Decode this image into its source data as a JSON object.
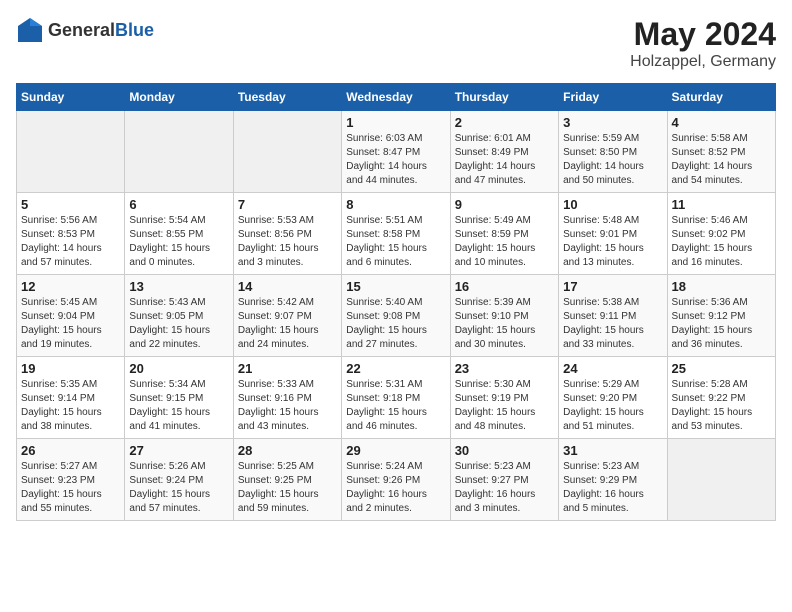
{
  "logo": {
    "general": "General",
    "blue": "Blue"
  },
  "title": "May 2024",
  "subtitle": "Holzappel, Germany",
  "days_of_week": [
    "Sunday",
    "Monday",
    "Tuesday",
    "Wednesday",
    "Thursday",
    "Friday",
    "Saturday"
  ],
  "weeks": [
    [
      {
        "day": "",
        "content": ""
      },
      {
        "day": "",
        "content": ""
      },
      {
        "day": "",
        "content": ""
      },
      {
        "day": "1",
        "content": "Sunrise: 6:03 AM\nSunset: 8:47 PM\nDaylight: 14 hours\nand 44 minutes."
      },
      {
        "day": "2",
        "content": "Sunrise: 6:01 AM\nSunset: 8:49 PM\nDaylight: 14 hours\nand 47 minutes."
      },
      {
        "day": "3",
        "content": "Sunrise: 5:59 AM\nSunset: 8:50 PM\nDaylight: 14 hours\nand 50 minutes."
      },
      {
        "day": "4",
        "content": "Sunrise: 5:58 AM\nSunset: 8:52 PM\nDaylight: 14 hours\nand 54 minutes."
      }
    ],
    [
      {
        "day": "5",
        "content": "Sunrise: 5:56 AM\nSunset: 8:53 PM\nDaylight: 14 hours\nand 57 minutes."
      },
      {
        "day": "6",
        "content": "Sunrise: 5:54 AM\nSunset: 8:55 PM\nDaylight: 15 hours\nand 0 minutes."
      },
      {
        "day": "7",
        "content": "Sunrise: 5:53 AM\nSunset: 8:56 PM\nDaylight: 15 hours\nand 3 minutes."
      },
      {
        "day": "8",
        "content": "Sunrise: 5:51 AM\nSunset: 8:58 PM\nDaylight: 15 hours\nand 6 minutes."
      },
      {
        "day": "9",
        "content": "Sunrise: 5:49 AM\nSunset: 8:59 PM\nDaylight: 15 hours\nand 10 minutes."
      },
      {
        "day": "10",
        "content": "Sunrise: 5:48 AM\nSunset: 9:01 PM\nDaylight: 15 hours\nand 13 minutes."
      },
      {
        "day": "11",
        "content": "Sunrise: 5:46 AM\nSunset: 9:02 PM\nDaylight: 15 hours\nand 16 minutes."
      }
    ],
    [
      {
        "day": "12",
        "content": "Sunrise: 5:45 AM\nSunset: 9:04 PM\nDaylight: 15 hours\nand 19 minutes."
      },
      {
        "day": "13",
        "content": "Sunrise: 5:43 AM\nSunset: 9:05 PM\nDaylight: 15 hours\nand 22 minutes."
      },
      {
        "day": "14",
        "content": "Sunrise: 5:42 AM\nSunset: 9:07 PM\nDaylight: 15 hours\nand 24 minutes."
      },
      {
        "day": "15",
        "content": "Sunrise: 5:40 AM\nSunset: 9:08 PM\nDaylight: 15 hours\nand 27 minutes."
      },
      {
        "day": "16",
        "content": "Sunrise: 5:39 AM\nSunset: 9:10 PM\nDaylight: 15 hours\nand 30 minutes."
      },
      {
        "day": "17",
        "content": "Sunrise: 5:38 AM\nSunset: 9:11 PM\nDaylight: 15 hours\nand 33 minutes."
      },
      {
        "day": "18",
        "content": "Sunrise: 5:36 AM\nSunset: 9:12 PM\nDaylight: 15 hours\nand 36 minutes."
      }
    ],
    [
      {
        "day": "19",
        "content": "Sunrise: 5:35 AM\nSunset: 9:14 PM\nDaylight: 15 hours\nand 38 minutes."
      },
      {
        "day": "20",
        "content": "Sunrise: 5:34 AM\nSunset: 9:15 PM\nDaylight: 15 hours\nand 41 minutes."
      },
      {
        "day": "21",
        "content": "Sunrise: 5:33 AM\nSunset: 9:16 PM\nDaylight: 15 hours\nand 43 minutes."
      },
      {
        "day": "22",
        "content": "Sunrise: 5:31 AM\nSunset: 9:18 PM\nDaylight: 15 hours\nand 46 minutes."
      },
      {
        "day": "23",
        "content": "Sunrise: 5:30 AM\nSunset: 9:19 PM\nDaylight: 15 hours\nand 48 minutes."
      },
      {
        "day": "24",
        "content": "Sunrise: 5:29 AM\nSunset: 9:20 PM\nDaylight: 15 hours\nand 51 minutes."
      },
      {
        "day": "25",
        "content": "Sunrise: 5:28 AM\nSunset: 9:22 PM\nDaylight: 15 hours\nand 53 minutes."
      }
    ],
    [
      {
        "day": "26",
        "content": "Sunrise: 5:27 AM\nSunset: 9:23 PM\nDaylight: 15 hours\nand 55 minutes."
      },
      {
        "day": "27",
        "content": "Sunrise: 5:26 AM\nSunset: 9:24 PM\nDaylight: 15 hours\nand 57 minutes."
      },
      {
        "day": "28",
        "content": "Sunrise: 5:25 AM\nSunset: 9:25 PM\nDaylight: 15 hours\nand 59 minutes."
      },
      {
        "day": "29",
        "content": "Sunrise: 5:24 AM\nSunset: 9:26 PM\nDaylight: 16 hours\nand 2 minutes."
      },
      {
        "day": "30",
        "content": "Sunrise: 5:23 AM\nSunset: 9:27 PM\nDaylight: 16 hours\nand 3 minutes."
      },
      {
        "day": "31",
        "content": "Sunrise: 5:23 AM\nSunset: 9:29 PM\nDaylight: 16 hours\nand 5 minutes."
      },
      {
        "day": "",
        "content": ""
      }
    ]
  ]
}
